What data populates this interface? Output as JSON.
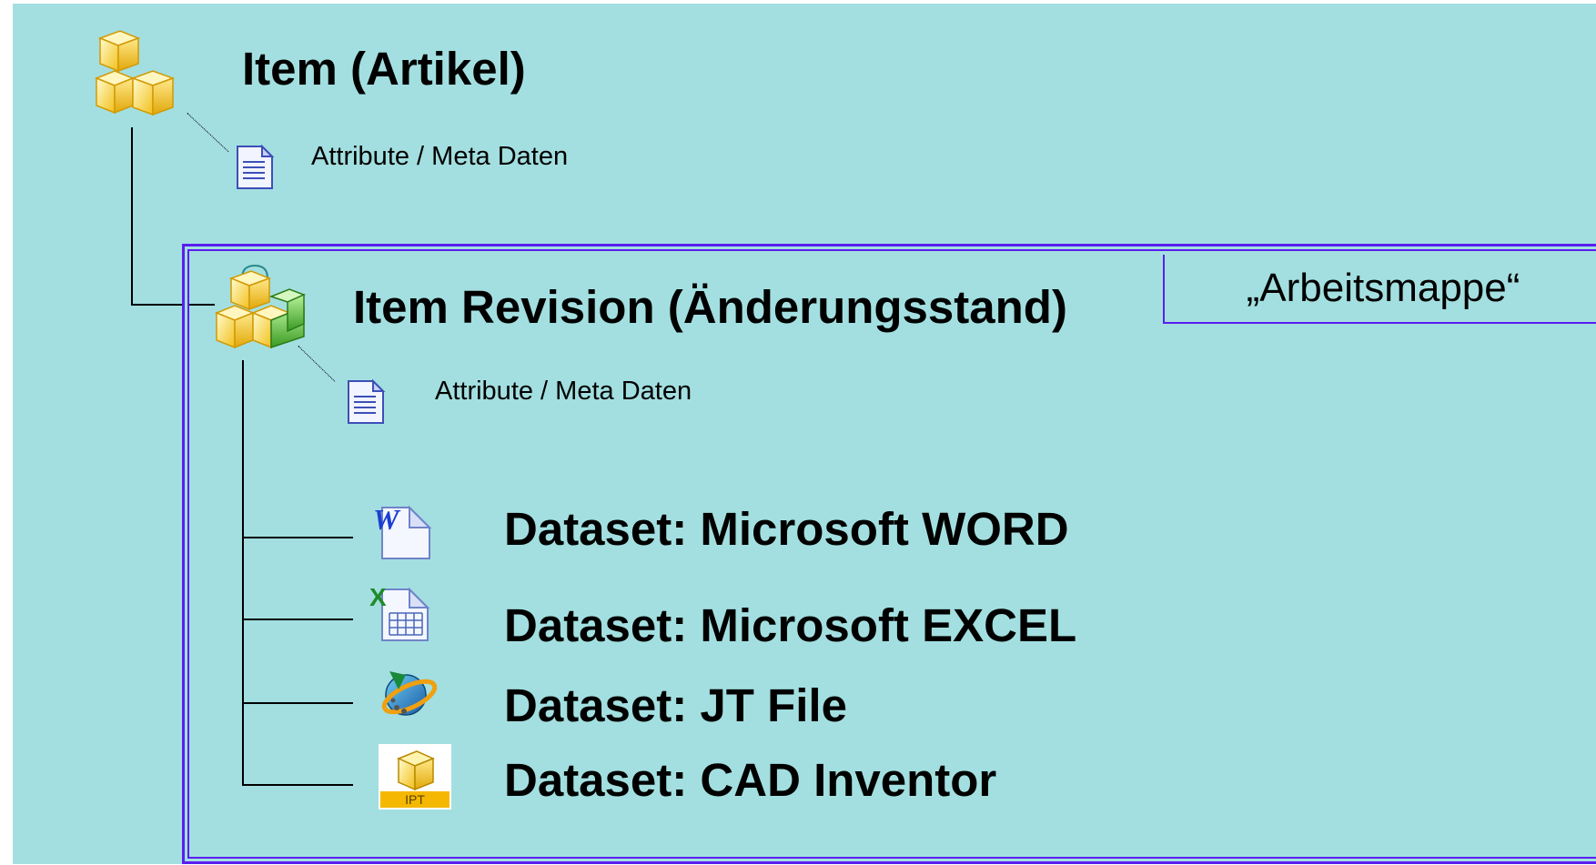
{
  "item": {
    "title": "Item (Artikel)",
    "attributes": "Attribute / Meta Daten",
    "icon": "item-cubes-icon"
  },
  "revision": {
    "title": "Item Revision (Änderungsstand)",
    "attributes": "Attribute / Meta Daten",
    "workbook_label": "„Arbeitsmappe“",
    "icon": "item-revision-cubes-icon",
    "border_color": "#5a1ef0"
  },
  "datasets": [
    {
      "label": "Dataset: Microsoft WORD",
      "icon": "word-document-icon"
    },
    {
      "label": "Dataset: Microsoft EXCEL",
      "icon": "excel-spreadsheet-icon"
    },
    {
      "label": "Dataset: JT File",
      "icon": "jt-file-icon"
    },
    {
      "label": "Dataset: CAD Inventor",
      "icon": "inventor-ipt-icon",
      "badge": "IPT"
    }
  ],
  "colors": {
    "background": "#a3dfe0",
    "accent": "#5a1ef0"
  }
}
